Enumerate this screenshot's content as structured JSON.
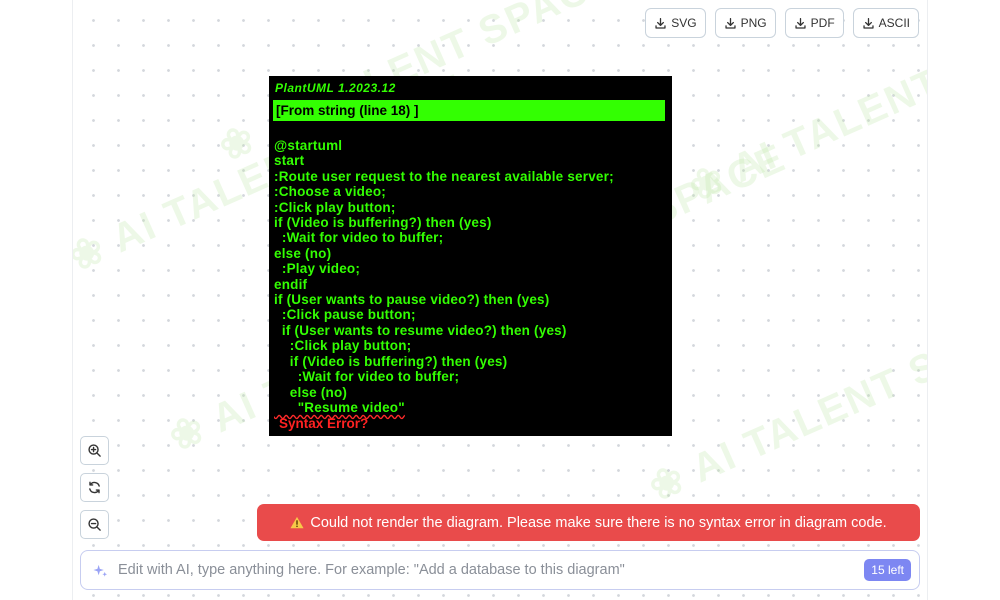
{
  "export": {
    "buttons": [
      {
        "label": "SVG"
      },
      {
        "label": "PNG"
      },
      {
        "label": "PDF"
      },
      {
        "label": "ASCII"
      }
    ]
  },
  "watermark": {
    "text": "AI TALENT SPACE"
  },
  "diagram": {
    "version": "PlantUML 1.2023.12",
    "banner": "[From string (line 18) ]",
    "code_lines": [
      "@startuml",
      "start",
      ":Route user request to the nearest available server;",
      ":Choose a video;",
      ":Click play button;",
      "if (Video is buffering?) then (yes)",
      "  :Wait for video to buffer;",
      "else (no)",
      "  :Play video;",
      "endif",
      "if (User wants to pause video?) then (yes)",
      "  :Click pause button;",
      "  if (User wants to resume video?) then (yes)",
      "    :Click play button;",
      "    if (Video is buffering?) then (yes)",
      "      :Wait for video to buffer;",
      "    else (no)",
      "      \"Resume video\""
    ],
    "error_text": "Syntax Error?"
  },
  "zoom": {
    "in_icon": "zoom-in-icon",
    "reset_icon": "refresh-icon",
    "out_icon": "zoom-out-icon"
  },
  "toast": {
    "message": "Could not render the diagram. Please make sure there is no syntax error in diagram code.",
    "color": "#e94b4b"
  },
  "ai_input": {
    "placeholder": "Edit with AI, type anything here. For example: \"Add a database to this diagram\"",
    "value": "",
    "remaining": "15 left"
  },
  "colors": {
    "uml_green": "#33ff02",
    "uml_error": "#ff2222",
    "badge": "#7d87f2"
  }
}
